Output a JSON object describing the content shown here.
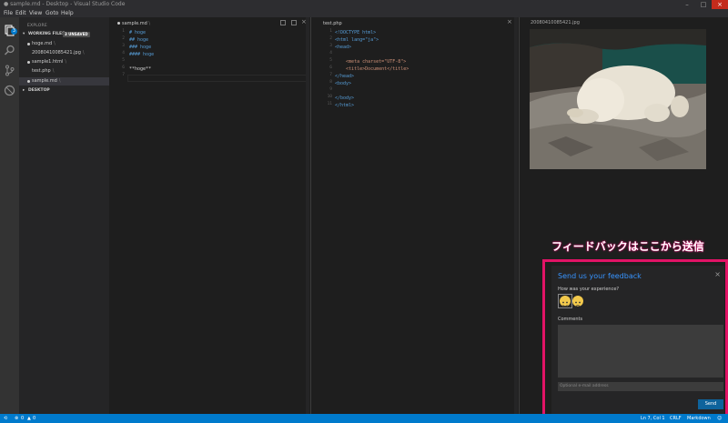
{
  "window": {
    "title": "● sample.md - Desktop - Visual Studio Code"
  },
  "menu": [
    "File",
    "Edit",
    "View",
    "Goto",
    "Help"
  ],
  "activity_badge": "3",
  "sidebar": {
    "header": "EXPLORE",
    "working_files_label": "WORKING FILES",
    "unsaved_badge": "3 UNSAVED",
    "desktop_label": "DESKTOP",
    "files": [
      {
        "name": "hoge.md",
        "path": "\\",
        "dirty": true
      },
      {
        "name": "20080410085421.jpg",
        "path": "\\",
        "dirty": false
      },
      {
        "name": "sample1.html",
        "path": "\\",
        "dirty": true
      },
      {
        "name": "test.php",
        "path": "\\",
        "dirty": false
      },
      {
        "name": "sample.md",
        "path": "\\",
        "dirty": true
      }
    ]
  },
  "editor1": {
    "title": "sample.md",
    "path": "\\",
    "lines": [
      "# hoge",
      "## hoge",
      "### hoge",
      "#### hoge",
      "",
      "**hoge**",
      ""
    ]
  },
  "editor2": {
    "title": "test.php",
    "lines": [
      "<!DOCTYPE html>",
      "<html lang=\"ja\">",
      "<head>",
      "",
      "    <meta charset=\"UTF-8\">",
      "    <title>Document</title>",
      "</head>",
      "<body>",
      "",
      "</body>",
      "</html>"
    ]
  },
  "image_viewer": {
    "title": "20080410085421.jpg"
  },
  "annotation": "フィードバックはここから送信",
  "feedback": {
    "title": "Send us your feedback",
    "close": "×",
    "question": "How was your experience?",
    "comments_label": "Comments",
    "email_placeholder": "Optional e-mail address",
    "send_label": "Send"
  },
  "status": {
    "errors": "0",
    "warnings": "0",
    "position": "Ln 7, Col 1",
    "eol": "CRLF",
    "language": "Markdown"
  },
  "colors": {
    "accent": "#007acc",
    "annotation": "#e21366",
    "link": "#3794ff"
  }
}
